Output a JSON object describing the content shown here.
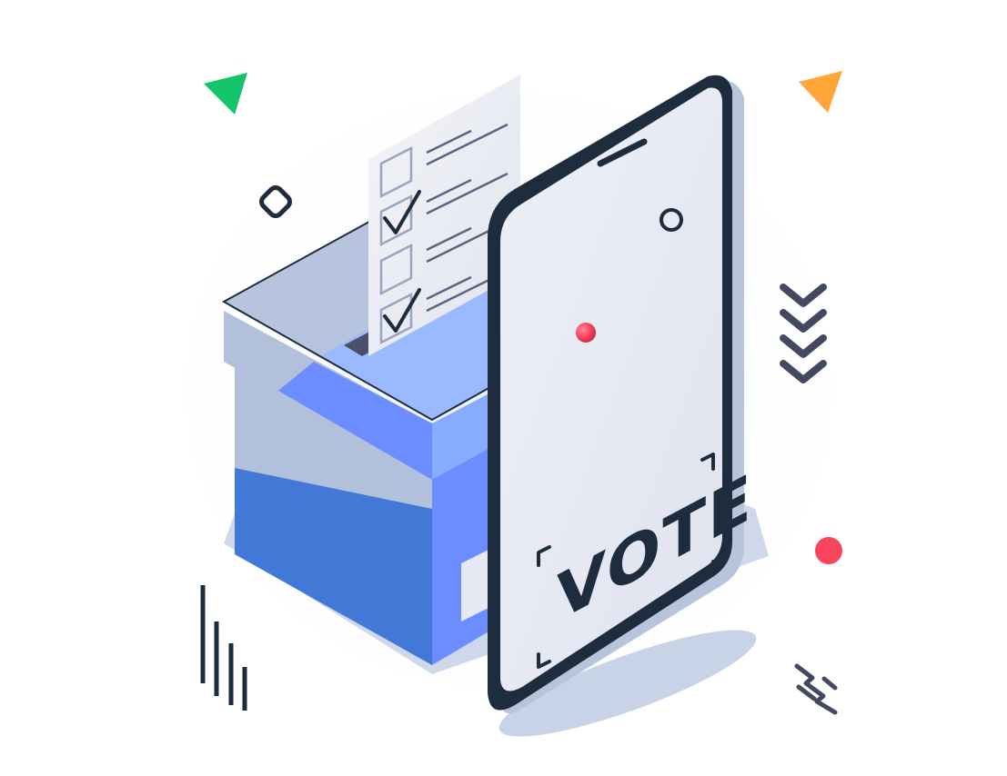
{
  "illustration": {
    "subject": "online-voting",
    "phone_screen_text": "VOTE",
    "ballot": {
      "rows": [
        {
          "checked": false
        },
        {
          "checked": true
        },
        {
          "checked": false
        },
        {
          "checked": true
        }
      ]
    },
    "icons": [
      "green-triangle-icon",
      "orange-triangle-icon",
      "rounded-diamond-icon",
      "ring-icon",
      "triple-chevron-down-icon",
      "red-dot-icon",
      "vertical-bars-icon",
      "zigzag-icon",
      "check-icon",
      "phone-icon",
      "ballot-box-icon"
    ]
  },
  "colors": {
    "background": "#ffffff",
    "box_front": "#4379d6",
    "box_side": "#6b8dff",
    "box_top": "#8aaeff",
    "box_lid_grey": "#b1c0db",
    "phone_frame": "#1e2d3d",
    "phone_screen": "#e6e9f3",
    "ballot_paper": "#eef0f6",
    "green_accent": "#14c46a",
    "orange_accent": "#ffa53a",
    "red_accent": "#f8445d",
    "dark_line": "#2d3445",
    "chevron_grey": "#434a5f"
  }
}
